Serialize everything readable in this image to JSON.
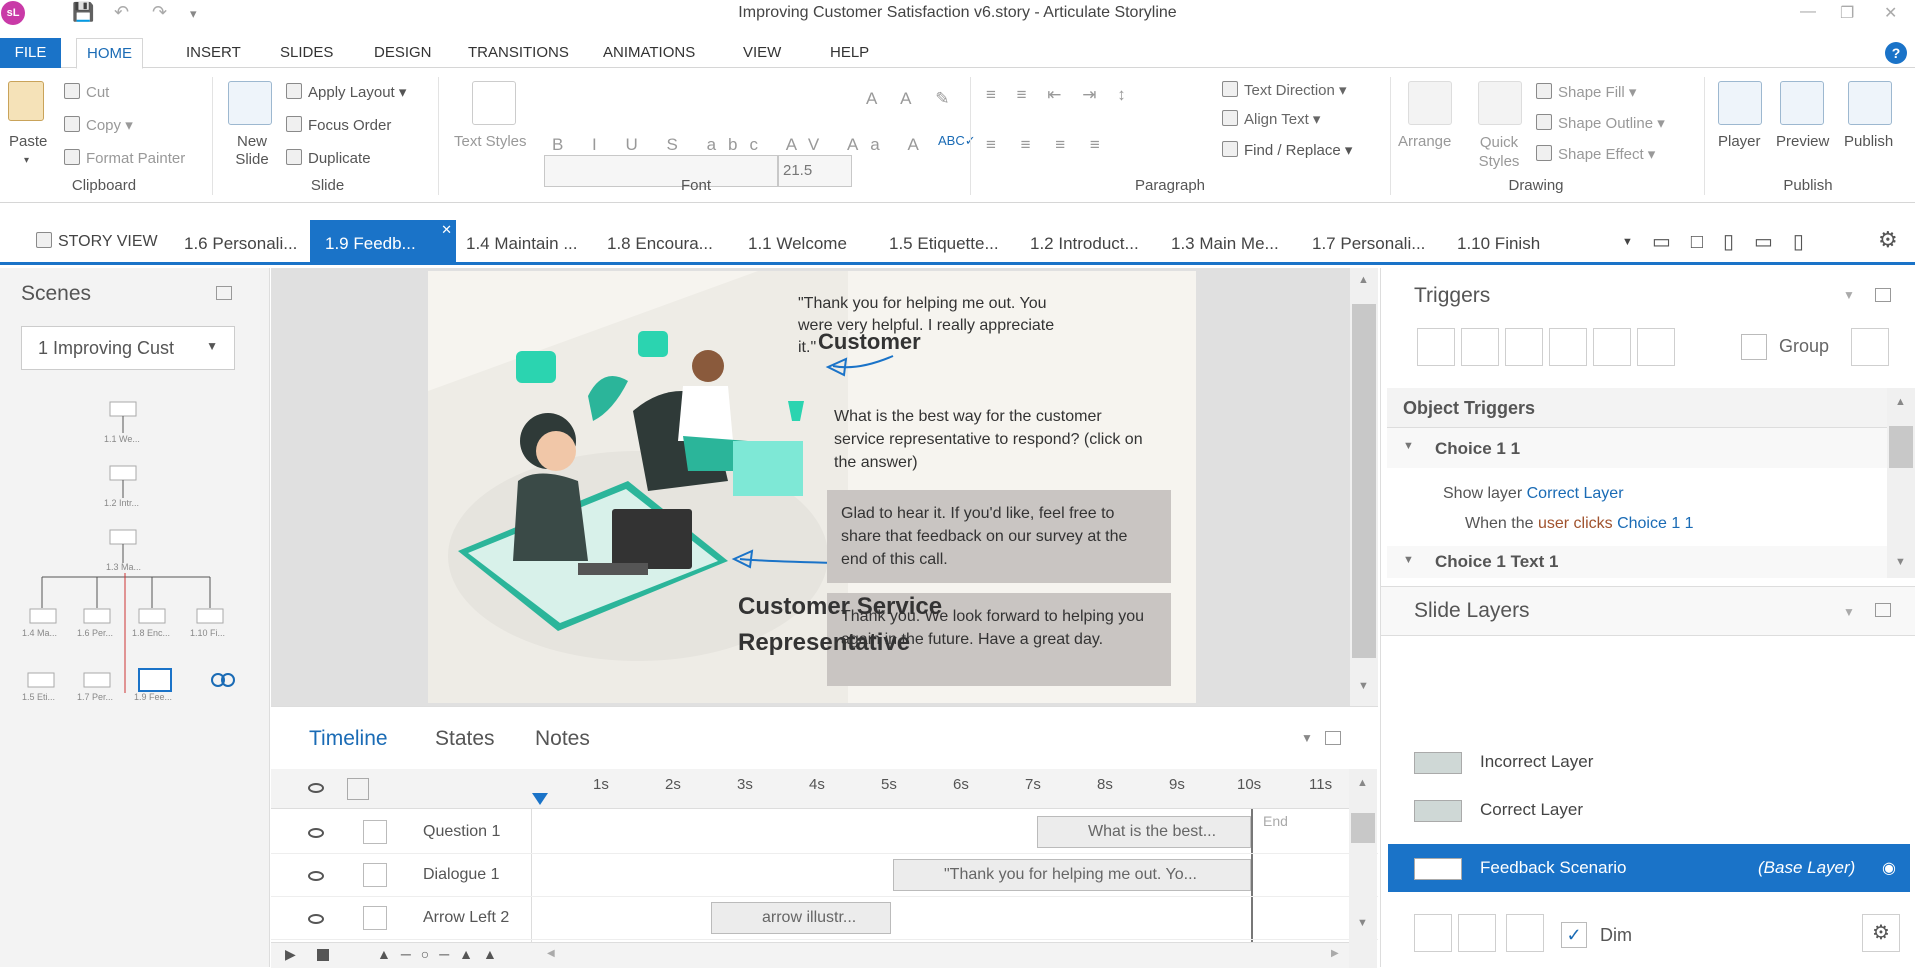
{
  "window": {
    "logo": "sL",
    "title": "Improving Customer Satisfaction v6.story - Articulate Storyline"
  },
  "ribbon_tabs": [
    "FILE",
    "HOME",
    "INSERT",
    "SLIDES",
    "DESIGN",
    "TRANSITIONS",
    "ANIMATIONS",
    "VIEW",
    "HELP"
  ],
  "clipboard": {
    "paste": "Paste",
    "cut": "Cut",
    "copy": "Copy",
    "format_painter": "Format Painter",
    "group": "Clipboard"
  },
  "slide_group": {
    "new_slide": "New Slide",
    "apply_layout": "Apply Layout",
    "focus_order": "Focus Order",
    "duplicate": "Duplicate",
    "group": "Slide"
  },
  "font_group": {
    "text_styles": "Text Styles",
    "size": "21.5",
    "group": "Font"
  },
  "paragraph_group": {
    "text_direction": "Text Direction",
    "align_text": "Align Text",
    "find_replace": "Find / Replace",
    "group": "Paragraph"
  },
  "drawing_group": {
    "arrange": "Arrange",
    "quick_styles": "Quick Styles",
    "shape_fill": "Shape Fill",
    "shape_outline": "Shape Outline",
    "shape_effect": "Shape Effect",
    "group": "Drawing"
  },
  "publish_group": {
    "player": "Player",
    "preview": "Preview",
    "publish": "Publish",
    "group": "Publish"
  },
  "slide_tabs": {
    "story_view": "STORY VIEW",
    "tabs": [
      "1.6 Personali...",
      "1.9 Feedb...",
      "1.4 Maintain ...",
      "1.8 Encoura...",
      "1.1 Welcome",
      "1.5 Etiquette...",
      "1.2 Introduct...",
      "1.3 Main Me...",
      "1.7 Personali...",
      "1.10 Finish"
    ]
  },
  "scenes": {
    "title": "Scenes",
    "selected": "1 Improving Cust",
    "nodes": [
      "1.1 We...",
      "1.2 Intr...",
      "1.3 Ma...",
      "1.4 Ma...",
      "1.6 Per...",
      "1.8 Enc...",
      "1.10 Fi...",
      "1.5 Eti...",
      "1.7 Per...",
      "1.9 Fee..."
    ]
  },
  "slide": {
    "quote": "\"Thank you for helping me out. You were very helpful. I really appreciate it.\"",
    "customer": "Customer",
    "question": "What is the best way for the customer service representative to respond? (click on the answer)",
    "answer1": "Glad to hear it. If you'd like, feel free to share that feedback on our survey at the end of this call.",
    "answer2": "Thank you. We look forward to helping you again in the future. Have a great day.",
    "rep": "Customer Service Representative"
  },
  "timeline": {
    "tabs": [
      "Timeline",
      "States",
      "Notes"
    ],
    "ticks": [
      "1s",
      "2s",
      "3s",
      "4s",
      "5s",
      "6s",
      "7s",
      "8s",
      "9s",
      "10s",
      "11s"
    ],
    "end_label": "End",
    "rows": [
      {
        "name": "Question 1",
        "block": "What is the best..."
      },
      {
        "name": "Dialogue 1",
        "block": "\"Thank you for helping me out. Yo..."
      },
      {
        "name": "Arrow Left 2",
        "block": "arrow illustr..."
      }
    ]
  },
  "triggers": {
    "title": "Triggers",
    "group_label": "Group",
    "object_triggers": "Object Triggers",
    "choice1": "Choice 1 1",
    "show_layer": "Show layer",
    "correct_layer": "Correct Layer",
    "when_the": "When the",
    "user_clicks": "user clicks",
    "choice_ref": "Choice 1 1",
    "choice_text": "Choice 1 Text 1"
  },
  "slide_layers": {
    "title": "Slide Layers",
    "layers": [
      "Incorrect Layer",
      "Correct Layer"
    ],
    "base": "Feedback Scenario",
    "base_tag": "(Base Layer)",
    "dim": "Dim"
  },
  "colors": {
    "accent": "#1a73c8",
    "teal": "#2bb59a"
  }
}
